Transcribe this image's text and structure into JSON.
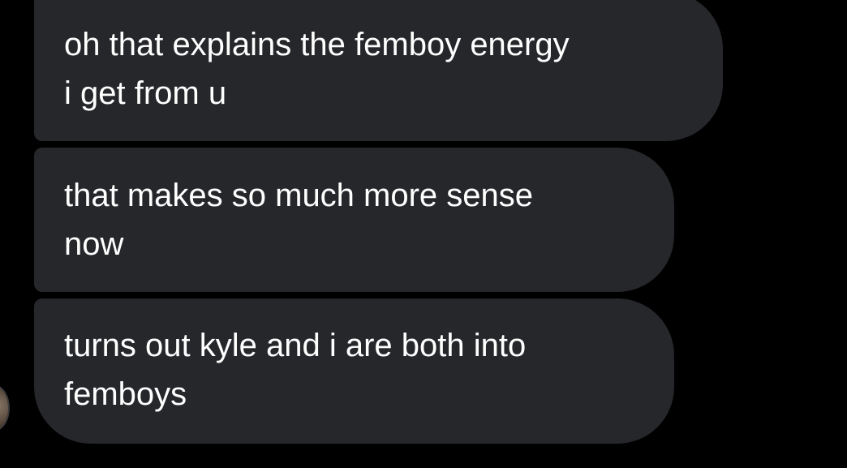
{
  "conversation": {
    "messages": [
      {
        "text": "oh that explains the femboy energy\ni get from u"
      },
      {
        "text": "that makes so much more sense\nnow"
      },
      {
        "text": "turns out kyle and i are both into\nfemboys"
      }
    ]
  },
  "colors": {
    "background": "#000000",
    "bubble": "#26272b",
    "text": "#ffffff"
  }
}
